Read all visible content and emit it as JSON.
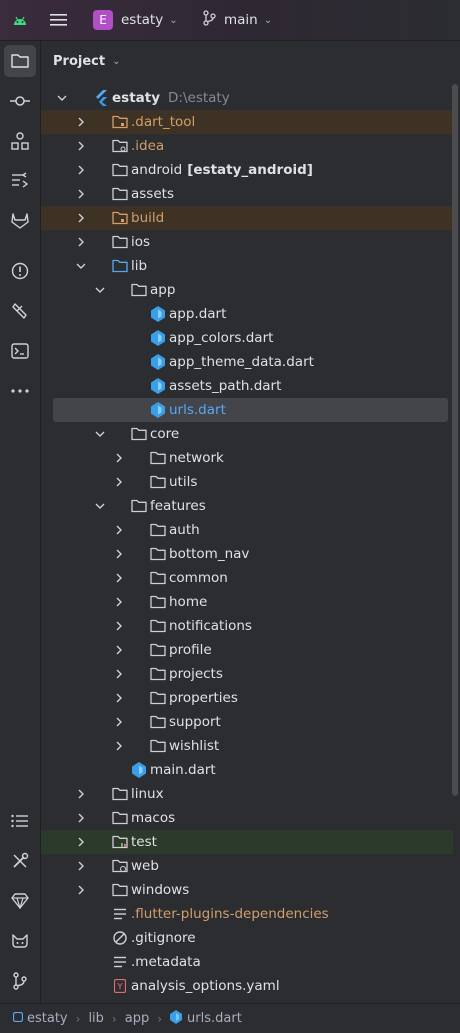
{
  "titlebar": {
    "app_icon": "android-icon",
    "menu_icon": "hamburger-menu-icon",
    "project_initial": "E",
    "project_name": "estaty",
    "branch_icon": "git-branch-icon",
    "branch_name": "main"
  },
  "tool_window_bar": {
    "top": [
      "project-icon",
      "commit-icon",
      "structure-icon",
      "pull-requests-icon",
      "gitlab-icon",
      "problems-icon",
      "flutter-inspector-icon",
      "terminal-icon",
      "more-icon"
    ],
    "bottom": [
      "todo-icon",
      "build-icon",
      "gem-icon",
      "gitlab-cat-icon",
      "git-icon"
    ]
  },
  "panel": {
    "title": "Project"
  },
  "tree": [
    {
      "label": "estaty",
      "path": "D:\\estaty",
      "depth": 0,
      "arrow": "expanded",
      "icon": "flutter",
      "style": "bold"
    },
    {
      "label": ".dart_tool",
      "depth": 1,
      "arrow": "collapsed",
      "icon": "folder-excluded",
      "style": "orange",
      "bg": "excluded"
    },
    {
      "label": ".idea",
      "depth": 1,
      "arrow": "collapsed",
      "icon": "folder-config",
      "style": "orange"
    },
    {
      "label": "android",
      "module": "[estaty_android]",
      "depth": 1,
      "arrow": "collapsed",
      "icon": "folder"
    },
    {
      "label": "assets",
      "depth": 1,
      "arrow": "collapsed",
      "icon": "folder"
    },
    {
      "label": "build",
      "depth": 1,
      "arrow": "collapsed",
      "icon": "folder-excluded",
      "style": "orange",
      "bg": "excluded"
    },
    {
      "label": "ios",
      "depth": 1,
      "arrow": "collapsed",
      "icon": "folder"
    },
    {
      "label": "lib",
      "depth": 1,
      "arrow": "expanded",
      "icon": "folder-source"
    },
    {
      "label": "app",
      "depth": 2,
      "arrow": "expanded",
      "icon": "folder"
    },
    {
      "label": "app.dart",
      "depth": 3,
      "icon": "dart"
    },
    {
      "label": "app_colors.dart",
      "depth": 3,
      "icon": "dart"
    },
    {
      "label": "app_theme_data.dart",
      "depth": 3,
      "icon": "dart"
    },
    {
      "label": "assets_path.dart",
      "depth": 3,
      "icon": "dart"
    },
    {
      "label": "urls.dart",
      "depth": 3,
      "icon": "dart",
      "style": "blue",
      "bg": "selected"
    },
    {
      "label": "core",
      "depth": 2,
      "arrow": "expanded",
      "icon": "folder"
    },
    {
      "label": "network",
      "depth": 3,
      "arrow": "collapsed",
      "icon": "folder"
    },
    {
      "label": "utils",
      "depth": 3,
      "arrow": "collapsed",
      "icon": "folder"
    },
    {
      "label": "features",
      "depth": 2,
      "arrow": "expanded",
      "icon": "folder"
    },
    {
      "label": "auth",
      "depth": 3,
      "arrow": "collapsed",
      "icon": "folder"
    },
    {
      "label": "bottom_nav",
      "depth": 3,
      "arrow": "collapsed",
      "icon": "folder"
    },
    {
      "label": "common",
      "depth": 3,
      "arrow": "collapsed",
      "icon": "folder"
    },
    {
      "label": "home",
      "depth": 3,
      "arrow": "collapsed",
      "icon": "folder"
    },
    {
      "label": "notifications",
      "depth": 3,
      "arrow": "collapsed",
      "icon": "folder"
    },
    {
      "label": "profile",
      "depth": 3,
      "arrow": "collapsed",
      "icon": "folder"
    },
    {
      "label": "projects",
      "depth": 3,
      "arrow": "collapsed",
      "icon": "folder"
    },
    {
      "label": "properties",
      "depth": 3,
      "arrow": "collapsed",
      "icon": "folder"
    },
    {
      "label": "support",
      "depth": 3,
      "arrow": "collapsed",
      "icon": "folder"
    },
    {
      "label": "wishlist",
      "depth": 3,
      "arrow": "collapsed",
      "icon": "folder"
    },
    {
      "label": "main.dart",
      "depth": 2,
      "icon": "dart"
    },
    {
      "label": "linux",
      "depth": 1,
      "arrow": "collapsed",
      "icon": "folder"
    },
    {
      "label": "macos",
      "depth": 1,
      "arrow": "collapsed",
      "icon": "folder"
    },
    {
      "label": "test",
      "depth": 1,
      "arrow": "collapsed",
      "icon": "folder-test",
      "bg": "testdir"
    },
    {
      "label": "web",
      "depth": 1,
      "arrow": "collapsed",
      "icon": "folder-web"
    },
    {
      "label": "windows",
      "depth": 1,
      "arrow": "collapsed",
      "icon": "folder"
    },
    {
      "label": ".flutter-plugins-dependencies",
      "depth": 1,
      "icon": "text-file",
      "style": "orange"
    },
    {
      "label": ".gitignore",
      "depth": 1,
      "icon": "ignore-file"
    },
    {
      "label": ".metadata",
      "depth": 1,
      "icon": "text-file"
    },
    {
      "label": "analysis_options.yaml",
      "depth": 1,
      "icon": "yaml-file"
    }
  ],
  "breadcrumbs": [
    {
      "label": "estaty",
      "icon": "module-icon"
    },
    {
      "label": "lib"
    },
    {
      "label": "app"
    },
    {
      "label": "urls.dart",
      "icon": "dart-file-icon"
    }
  ],
  "colors": {
    "background": "#2b2d30",
    "excluded_row": "#3d3223",
    "test_row": "#2c3a2c",
    "selected_row": "#43454a",
    "orange_text": "#d39e6a",
    "blue_text": "#56a8f5",
    "dart_icon": "#3a9ee8",
    "project_badge": "#b04fc6"
  }
}
